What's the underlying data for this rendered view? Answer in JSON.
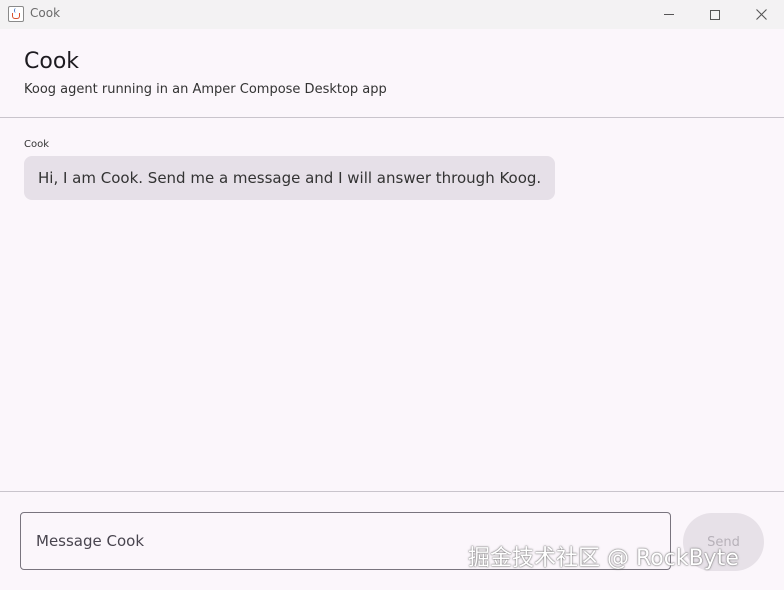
{
  "window": {
    "title": "Cook",
    "icon": "java-cup-icon"
  },
  "header": {
    "title": "Cook",
    "subtitle": "Koog agent running in an Amper Compose Desktop app"
  },
  "messages": [
    {
      "sender": "Cook",
      "text": "Hi, I am Cook. Send me a message and I will answer through Koog."
    }
  ],
  "composer": {
    "placeholder": "Message Cook",
    "value": "",
    "send_label": "Send"
  },
  "watermark": {
    "text": "掘金技术社区 @ RockByte"
  },
  "colors": {
    "background": "#fbf6fb",
    "bubble": "#e6e0e8",
    "send_disabled": "#e7e1e8"
  }
}
